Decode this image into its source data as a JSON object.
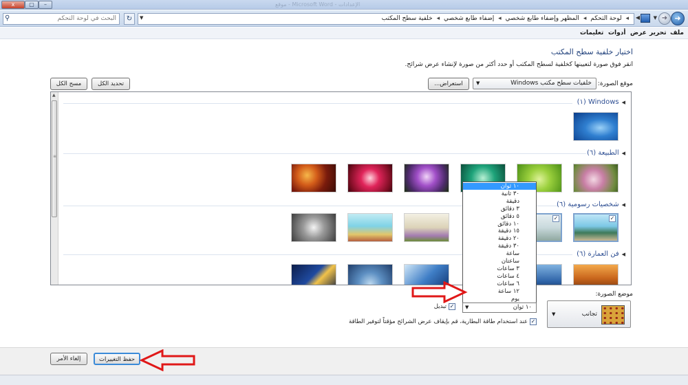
{
  "window": {
    "close_glyph": "x",
    "max_glyph": "▢",
    "min_glyph": "–",
    "faded_title": "موقع - Microsoft Word - الإعدادات"
  },
  "address": {
    "search_placeholder": "البحث في لوحة التحكم",
    "search_icon": "search-icon",
    "refresh_glyph": "↻",
    "breadcrumb": [
      "لوحة التحكم",
      "المظهر وإضفاء طابع شخصي",
      "إضفاء طابع شخصي",
      "خلفية سطح المكتب"
    ]
  },
  "menu": {
    "file": "ملف",
    "edit": "تحرير",
    "view": "عرض",
    "tools": "أدوات",
    "help": "تعليمات"
  },
  "page": {
    "title": "اختيار خلفية سطح المكتب",
    "instruction": "انقر فوق صورة لتعيينها كخلفية لسطح المكتب أو حدد أكثر من صورة لإنشاء عرض شرائح.",
    "location_label": "موقع الصورة:",
    "location_value": "خلفيات سطح مكتب Windows",
    "browse_label": "استعراض...",
    "select_all_label": "تحديد الكل",
    "clear_all_label": "مسح الكل"
  },
  "gallery": {
    "groups": [
      {
        "name": "Windows (١)"
      },
      {
        "name": "الطبيعة (٦)"
      },
      {
        "name": "شخصيات رسومية (٦)"
      },
      {
        "name": "فن العمارة (٦)"
      }
    ]
  },
  "interval": {
    "options": [
      "١٠ ثوان",
      "٣٠ ثانية",
      "دقيقة",
      "٣ دقائق",
      "٥ دقائق",
      "١٠ دقائق",
      "١٥ دقيقة",
      "٢٠ دقيقة",
      "٣٠ دقيقة",
      "ساعة",
      "ساعتان",
      "٣ ساعات",
      "٤ ساعات",
      "٦ ساعات",
      "١٢ ساعة",
      "يوم"
    ],
    "selected": "١٠ ثوان",
    "highlighted_index": 0,
    "shuffle_label": "تبديل",
    "shuffle_checked": true,
    "battery_label": "عند استخدام طاقة البطارية، قم بإيقاف عرض الشرائح مؤقتاً لتوفير الطاقة",
    "battery_checked": true
  },
  "position": {
    "label": "موضع الصورة:",
    "value": "تجانب"
  },
  "footer": {
    "save_label": "حفظ التغييرات",
    "cancel_label": "إلغاء الأمر"
  },
  "colors": {
    "accent": "#3399ff",
    "link_blue": "#2e4f93",
    "annotation_red": "#e01818"
  }
}
